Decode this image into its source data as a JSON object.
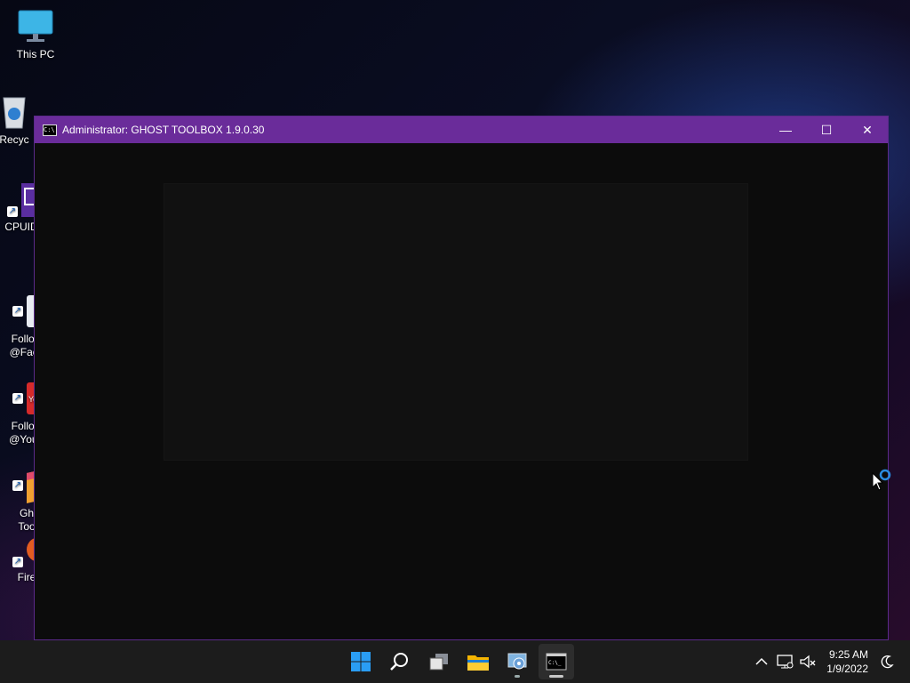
{
  "desktop": {
    "icons": [
      {
        "label": "This PC"
      },
      {
        "label": "Recyc"
      },
      {
        "label": "CPUID"
      },
      {
        "label": "Follow\n@Face"
      },
      {
        "label": "Follow\n@YouT"
      },
      {
        "label": "Gh\nToo"
      },
      {
        "label": "Fire"
      }
    ]
  },
  "window": {
    "title": "Administrator:  GHOST TOOLBOX 1.9.0.30",
    "minimize": "—",
    "maximize": "☐",
    "close": "✕"
  },
  "taskbar": {
    "time": "9:25 AM",
    "date": "1/9/2022"
  },
  "colors": {
    "titlebar": "#6a2c9a",
    "taskbar": "#1c1c1c",
    "accent": "#0078d4"
  }
}
